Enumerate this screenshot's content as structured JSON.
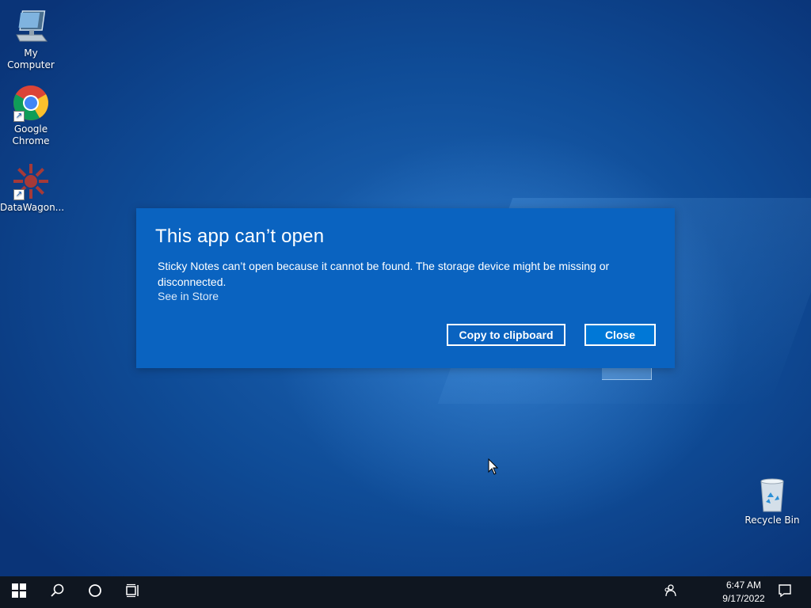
{
  "desktop": {
    "icons": [
      {
        "label": "My Computer",
        "icon": "computer-icon"
      },
      {
        "label": "Google Chrome",
        "icon": "chrome-icon"
      },
      {
        "label": "DataWagon...",
        "icon": "datawagon-icon"
      },
      {
        "label": "Recycle Bin",
        "icon": "recycle-bin-icon"
      }
    ]
  },
  "dialog": {
    "title": "This app can’t open",
    "message": "Sticky Notes can’t open because it cannot be found. The storage device might be missing or disconnected.",
    "link": "See in Store",
    "copy_button": "Copy to clipboard",
    "close_button": "Close"
  },
  "taskbar": {
    "time": "6:47 AM",
    "date": "9/17/2022",
    "buttons": [
      "windows-start-icon",
      "search-icon",
      "cortana-icon",
      "task-view-icon"
    ],
    "tray": [
      "people-icon",
      "notification-icon"
    ]
  },
  "colors": {
    "dialog_bg": "#0a63c0",
    "accent": "#0078d7",
    "taskbar_bg": "#0f1620"
  }
}
